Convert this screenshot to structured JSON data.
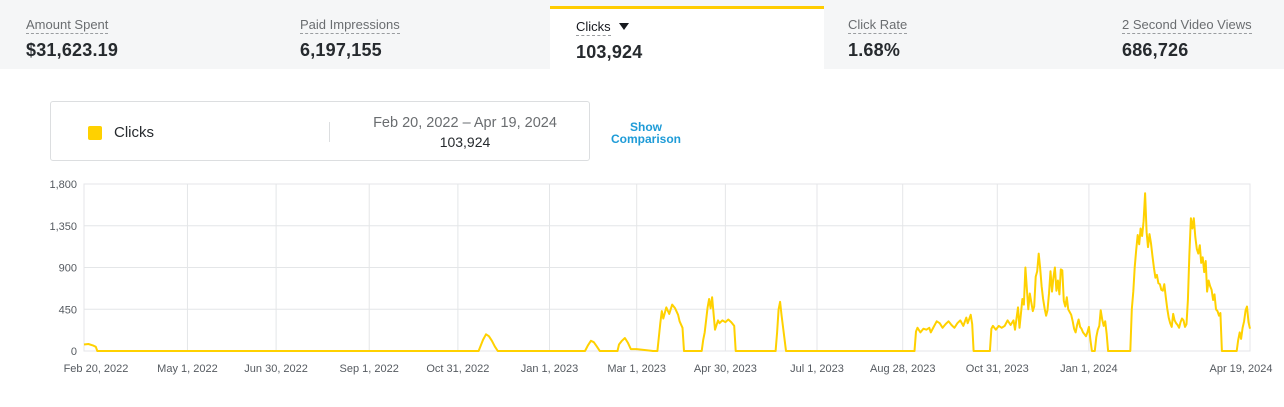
{
  "metrics": [
    {
      "label": "Amount Spent",
      "value": "$31,623.19"
    },
    {
      "label": "Paid Impressions",
      "value": "6,197,155"
    },
    {
      "label": "Clicks",
      "value": "103,924"
    },
    {
      "label": "Click Rate",
      "value": "1.68%"
    },
    {
      "label": "2 Second Video Views",
      "value": "686,726"
    }
  ],
  "legend": {
    "series_label": "Clicks",
    "date_range": "Feb 20, 2022 – Apr 19, 2024",
    "total": "103,924",
    "show_comparison": "Show Comparison"
  },
  "colors": {
    "accent": "#ffcc00",
    "line": "#ffd100",
    "link": "#1e9bd7"
  },
  "chart_data": {
    "type": "line",
    "grid": true,
    "ylim": [
      0,
      1800
    ],
    "ytick_values": [
      0,
      450,
      900,
      1350,
      1800
    ],
    "ytick_labels": [
      "0",
      "450",
      "900",
      "1,350",
      "1,800"
    ],
    "xticks": [
      {
        "date": "2022-02-20",
        "label": "Feb 20, 2022"
      },
      {
        "date": "2022-05-01",
        "label": "May 1, 2022"
      },
      {
        "date": "2022-06-30",
        "label": "Jun 30, 2022"
      },
      {
        "date": "2022-09-01",
        "label": "Sep 1, 2022"
      },
      {
        "date": "2022-10-31",
        "label": "Oct 31, 2022"
      },
      {
        "date": "2023-01-01",
        "label": "Jan 1, 2023"
      },
      {
        "date": "2023-03-01",
        "label": "Mar 1, 2023"
      },
      {
        "date": "2023-04-30",
        "label": "Apr 30, 2023"
      },
      {
        "date": "2023-07-01",
        "label": "Jul 1, 2023"
      },
      {
        "date": "2023-08-28",
        "label": "Aug 28, 2023"
      },
      {
        "date": "2023-10-31",
        "label": "Oct 31, 2023"
      },
      {
        "date": "2024-01-01",
        "label": "Jan 1, 2024"
      },
      {
        "date": "2024-04-19",
        "label": "Apr 19, 2024"
      }
    ],
    "series": [
      {
        "name": "Clicks",
        "points": [
          [
            "2022-02-20",
            70
          ],
          [
            "2022-02-23",
            75
          ],
          [
            "2022-02-26",
            60
          ],
          [
            "2022-02-28",
            45
          ],
          [
            "2022-03-01",
            0
          ],
          [
            "2022-11-14",
            0
          ],
          [
            "2022-11-17",
            120
          ],
          [
            "2022-11-19",
            180
          ],
          [
            "2022-11-21",
            160
          ],
          [
            "2022-11-23",
            110
          ],
          [
            "2022-11-25",
            50
          ],
          [
            "2022-11-27",
            0
          ],
          [
            "2023-01-25",
            0
          ],
          [
            "2023-01-27",
            60
          ],
          [
            "2023-01-29",
            110
          ],
          [
            "2023-01-31",
            95
          ],
          [
            "2023-02-02",
            50
          ],
          [
            "2023-02-04",
            0
          ],
          [
            "2023-02-16",
            0
          ],
          [
            "2023-02-17",
            70
          ],
          [
            "2023-02-19",
            110
          ],
          [
            "2023-02-21",
            140
          ],
          [
            "2023-02-23",
            90
          ],
          [
            "2023-02-25",
            20
          ],
          [
            "2023-03-01",
            20
          ],
          [
            "2023-03-07",
            10
          ],
          [
            "2023-03-12",
            0
          ],
          [
            "2023-03-15",
            0
          ],
          [
            "2023-03-17",
            300
          ],
          [
            "2023-03-18",
            430
          ],
          [
            "2023-03-19",
            350
          ],
          [
            "2023-03-21",
            470
          ],
          [
            "2023-03-23",
            400
          ],
          [
            "2023-03-25",
            500
          ],
          [
            "2023-03-27",
            460
          ],
          [
            "2023-03-29",
            390
          ],
          [
            "2023-03-30",
            320
          ],
          [
            "2023-04-01",
            250
          ],
          [
            "2023-04-02",
            0
          ],
          [
            "2023-04-14",
            0
          ],
          [
            "2023-04-15",
            120
          ],
          [
            "2023-04-16",
            200
          ],
          [
            "2023-04-18",
            470
          ],
          [
            "2023-04-19",
            560
          ],
          [
            "2023-04-20",
            460
          ],
          [
            "2023-04-21",
            580
          ],
          [
            "2023-04-22",
            400
          ],
          [
            "2023-04-23",
            230
          ],
          [
            "2023-04-25",
            330
          ],
          [
            "2023-04-26",
            300
          ],
          [
            "2023-04-28",
            330
          ],
          [
            "2023-04-30",
            310
          ],
          [
            "2023-05-02",
            340
          ],
          [
            "2023-05-04",
            310
          ],
          [
            "2023-05-06",
            270
          ],
          [
            "2023-05-07",
            0
          ],
          [
            "2023-06-03",
            0
          ],
          [
            "2023-06-04",
            200
          ],
          [
            "2023-06-05",
            450
          ],
          [
            "2023-06-06",
            530
          ],
          [
            "2023-06-07",
            390
          ],
          [
            "2023-06-09",
            130
          ],
          [
            "2023-06-10",
            0
          ],
          [
            "2023-09-05",
            0
          ],
          [
            "2023-09-06",
            210
          ],
          [
            "2023-09-07",
            250
          ],
          [
            "2023-09-09",
            200
          ],
          [
            "2023-09-11",
            240
          ],
          [
            "2023-09-13",
            230
          ],
          [
            "2023-09-15",
            250
          ],
          [
            "2023-09-16",
            200
          ],
          [
            "2023-09-18",
            260
          ],
          [
            "2023-09-20",
            320
          ],
          [
            "2023-09-22",
            300
          ],
          [
            "2023-09-24",
            250
          ],
          [
            "2023-09-26",
            290
          ],
          [
            "2023-09-28",
            320
          ],
          [
            "2023-09-30",
            280
          ],
          [
            "2023-10-02",
            250
          ],
          [
            "2023-10-04",
            300
          ],
          [
            "2023-10-06",
            330
          ],
          [
            "2023-10-08",
            270
          ],
          [
            "2023-10-10",
            360
          ],
          [
            "2023-10-11",
            300
          ],
          [
            "2023-10-13",
            390
          ],
          [
            "2023-10-14",
            290
          ],
          [
            "2023-10-15",
            0
          ],
          [
            "2023-10-26",
            0
          ],
          [
            "2023-10-27",
            240
          ],
          [
            "2023-10-28",
            270
          ],
          [
            "2023-10-30",
            230
          ],
          [
            "2023-11-01",
            270
          ],
          [
            "2023-11-03",
            250
          ],
          [
            "2023-11-05",
            270
          ],
          [
            "2023-11-07",
            330
          ],
          [
            "2023-11-09",
            280
          ],
          [
            "2023-11-11",
            330
          ],
          [
            "2023-11-12",
            230
          ],
          [
            "2023-11-14",
            470
          ],
          [
            "2023-11-15",
            250
          ],
          [
            "2023-11-17",
            560
          ],
          [
            "2023-11-18",
            500
          ],
          [
            "2023-11-19",
            900
          ],
          [
            "2023-11-20",
            680
          ],
          [
            "2023-11-21",
            450
          ],
          [
            "2023-11-22",
            620
          ],
          [
            "2023-11-24",
            430
          ],
          [
            "2023-11-25",
            480
          ],
          [
            "2023-11-26",
            800
          ],
          [
            "2023-11-27",
            860
          ],
          [
            "2023-11-28",
            1050
          ],
          [
            "2023-11-29",
            900
          ],
          [
            "2023-11-30",
            700
          ],
          [
            "2023-12-01",
            560
          ],
          [
            "2023-12-02",
            460
          ],
          [
            "2023-12-03",
            380
          ],
          [
            "2023-12-04",
            440
          ],
          [
            "2023-12-05",
            620
          ],
          [
            "2023-12-06",
            860
          ],
          [
            "2023-12-07",
            640
          ],
          [
            "2023-12-08",
            790
          ],
          [
            "2023-12-09",
            900
          ],
          [
            "2023-12-10",
            650
          ],
          [
            "2023-12-11",
            760
          ],
          [
            "2023-12-12",
            610
          ],
          [
            "2023-12-13",
            880
          ],
          [
            "2023-12-14",
            870
          ],
          [
            "2023-12-15",
            540
          ],
          [
            "2023-12-16",
            480
          ],
          [
            "2023-12-17",
            580
          ],
          [
            "2023-12-18",
            450
          ],
          [
            "2023-12-19",
            420
          ],
          [
            "2023-12-20",
            390
          ],
          [
            "2023-12-21",
            320
          ],
          [
            "2023-12-22",
            240
          ],
          [
            "2023-12-23",
            200
          ],
          [
            "2023-12-24",
            280
          ],
          [
            "2023-12-25",
            340
          ],
          [
            "2023-12-26",
            260
          ],
          [
            "2023-12-27",
            240
          ],
          [
            "2023-12-28",
            200
          ],
          [
            "2023-12-29",
            180
          ],
          [
            "2023-12-30",
            160
          ],
          [
            "2023-12-31",
            200
          ],
          [
            "2024-01-01",
            260
          ],
          [
            "2024-01-02",
            120
          ],
          [
            "2024-01-03",
            0
          ],
          [
            "2024-01-05",
            0
          ],
          [
            "2024-01-06",
            150
          ],
          [
            "2024-01-07",
            230
          ],
          [
            "2024-01-08",
            270
          ],
          [
            "2024-01-09",
            440
          ],
          [
            "2024-01-10",
            340
          ],
          [
            "2024-01-11",
            270
          ],
          [
            "2024-01-12",
            320
          ],
          [
            "2024-01-13",
            180
          ],
          [
            "2024-01-14",
            0
          ],
          [
            "2024-01-29",
            0
          ],
          [
            "2024-01-30",
            450
          ],
          [
            "2024-01-31",
            640
          ],
          [
            "2024-02-01",
            900
          ],
          [
            "2024-02-02",
            1090
          ],
          [
            "2024-02-03",
            1250
          ],
          [
            "2024-02-04",
            1150
          ],
          [
            "2024-02-05",
            1320
          ],
          [
            "2024-02-06",
            1240
          ],
          [
            "2024-02-07",
            1400
          ],
          [
            "2024-02-08",
            1700
          ],
          [
            "2024-02-09",
            1280
          ],
          [
            "2024-02-10",
            1120
          ],
          [
            "2024-02-11",
            1260
          ],
          [
            "2024-02-12",
            1160
          ],
          [
            "2024-02-13",
            1020
          ],
          [
            "2024-02-14",
            900
          ],
          [
            "2024-02-15",
            790
          ],
          [
            "2024-02-16",
            820
          ],
          [
            "2024-02-17",
            730
          ],
          [
            "2024-02-18",
            720
          ],
          [
            "2024-02-19",
            660
          ],
          [
            "2024-02-20",
            650
          ],
          [
            "2024-02-21",
            720
          ],
          [
            "2024-02-22",
            580
          ],
          [
            "2024-02-23",
            460
          ],
          [
            "2024-02-24",
            360
          ],
          [
            "2024-02-25",
            300
          ],
          [
            "2024-02-26",
            260
          ],
          [
            "2024-02-27",
            400
          ],
          [
            "2024-02-28",
            330
          ],
          [
            "2024-02-29",
            300
          ],
          [
            "2024-03-01",
            280
          ],
          [
            "2024-03-02",
            250
          ],
          [
            "2024-03-03",
            310
          ],
          [
            "2024-03-04",
            350
          ],
          [
            "2024-03-05",
            330
          ],
          [
            "2024-03-06",
            260
          ],
          [
            "2024-03-07",
            290
          ],
          [
            "2024-03-08",
            550
          ],
          [
            "2024-03-09",
            1050
          ],
          [
            "2024-03-10",
            1430
          ],
          [
            "2024-03-11",
            1320
          ],
          [
            "2024-03-12",
            1430
          ],
          [
            "2024-03-13",
            1230
          ],
          [
            "2024-03-14",
            1100
          ],
          [
            "2024-03-15",
            1050
          ],
          [
            "2024-03-16",
            1140
          ],
          [
            "2024-03-17",
            950
          ],
          [
            "2024-03-18",
            1010
          ],
          [
            "2024-03-19",
            850
          ],
          [
            "2024-03-20",
            970
          ],
          [
            "2024-03-21",
            640
          ],
          [
            "2024-03-22",
            760
          ],
          [
            "2024-03-23",
            700
          ],
          [
            "2024-03-24",
            660
          ],
          [
            "2024-03-25",
            550
          ],
          [
            "2024-03-26",
            610
          ],
          [
            "2024-03-27",
            450
          ],
          [
            "2024-03-28",
            430
          ],
          [
            "2024-03-29",
            380
          ],
          [
            "2024-03-30",
            410
          ],
          [
            "2024-03-31",
            0
          ],
          [
            "2024-04-10",
            0
          ],
          [
            "2024-04-11",
            120
          ],
          [
            "2024-04-12",
            200
          ],
          [
            "2024-04-13",
            130
          ],
          [
            "2024-04-14",
            250
          ],
          [
            "2024-04-15",
            320
          ],
          [
            "2024-04-16",
            440
          ],
          [
            "2024-04-17",
            480
          ],
          [
            "2024-04-18",
            310
          ],
          [
            "2024-04-19",
            240
          ]
        ]
      }
    ]
  }
}
